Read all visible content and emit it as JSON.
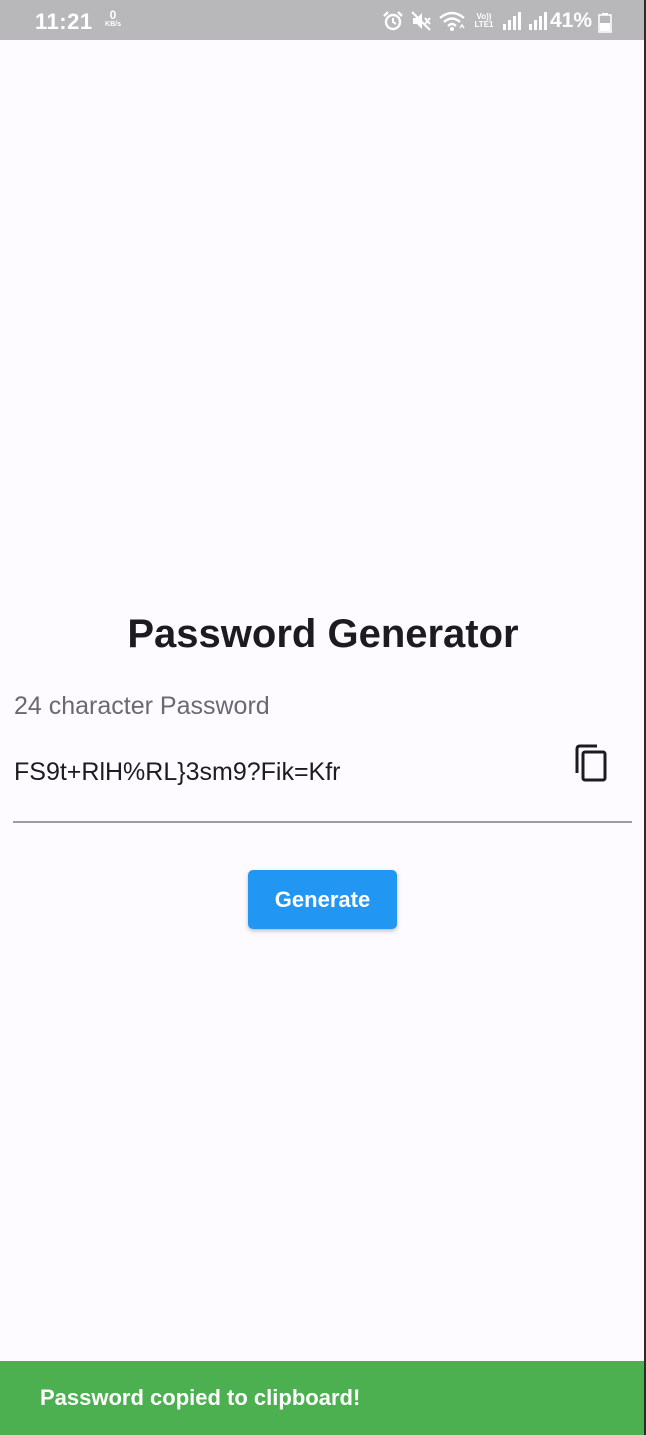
{
  "status_bar": {
    "time": "11:21",
    "net_speed_value": "0",
    "net_speed_unit": "KB/s",
    "volte_top": "Vo))",
    "volte_bottom": "LTE1",
    "battery_percent": "41%",
    "icons": [
      "alarm-icon",
      "mute-icon",
      "wifi-icon",
      "volte-icon",
      "signal-icon",
      "signal-icon",
      "battery-icon"
    ]
  },
  "main": {
    "title": "Password Generator",
    "field_label": "24 character Password",
    "password": "FS9t+RlH%RL}3sm9?Fik=Kfr",
    "copy_icon": "copy-icon",
    "generate_label": "Generate"
  },
  "snackbar": {
    "message": "Password copied to clipboard!"
  },
  "colors": {
    "status_bar": "#b8b8bb",
    "background": "#fdfbff",
    "button": "#2196f3",
    "snackbar": "#4caf50"
  }
}
